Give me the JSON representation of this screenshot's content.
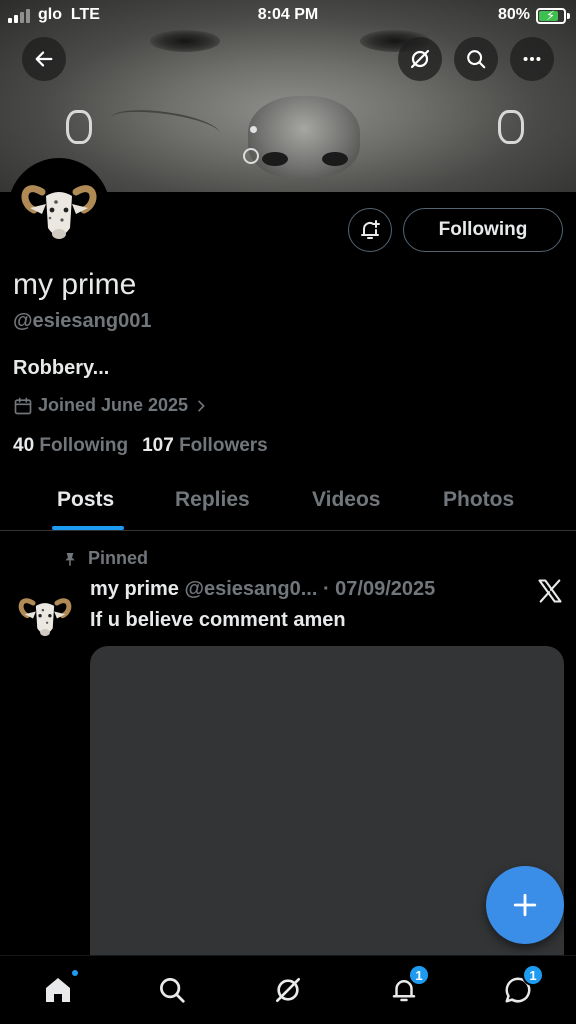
{
  "status_bar": {
    "carrier": "glo  LTE",
    "time": "8:04 PM",
    "battery_percent": "80%",
    "battery_level": 0.8,
    "charging": true
  },
  "header": {
    "back_icon": "arrow-left-icon",
    "grok_icon": "grok-icon",
    "search_icon": "search-icon",
    "more_icon": "more-horizontal-icon"
  },
  "profile": {
    "display_name": "my prime",
    "handle": "@esiesang001",
    "bio": "Robbery...",
    "joined": "Joined June 2025",
    "following_count": "40",
    "following_label": "Following",
    "followers_count": "107",
    "followers_label": "Followers",
    "follow_button_label": "Following",
    "notify_icon": "bell-plus-icon"
  },
  "tabs": [
    {
      "label": "Posts",
      "active": true
    },
    {
      "label": "Replies",
      "active": false
    },
    {
      "label": "Videos",
      "active": false
    },
    {
      "label": "Photos",
      "active": false
    }
  ],
  "pinned_post": {
    "pinned_label": "Pinned",
    "author_name": "my prime",
    "author_handle": "@esiesang0...",
    "date": "· 07/09/2025",
    "text": "If u believe comment amen",
    "source_icon": "x-logo-icon"
  },
  "fab": {
    "icon": "plus-icon"
  },
  "bottom_nav": {
    "home": {
      "icon": "home-icon",
      "has_dot": true
    },
    "search": {
      "icon": "search-icon"
    },
    "grok": {
      "icon": "grok-icon"
    },
    "notifications": {
      "icon": "bell-icon",
      "badge": "1"
    },
    "messages": {
      "icon": "message-icon",
      "badge": "1"
    }
  },
  "colors": {
    "accent": "#1d9bf0",
    "fab": "#3b8ee8",
    "muted_text": "#71767b",
    "background": "#000000"
  }
}
